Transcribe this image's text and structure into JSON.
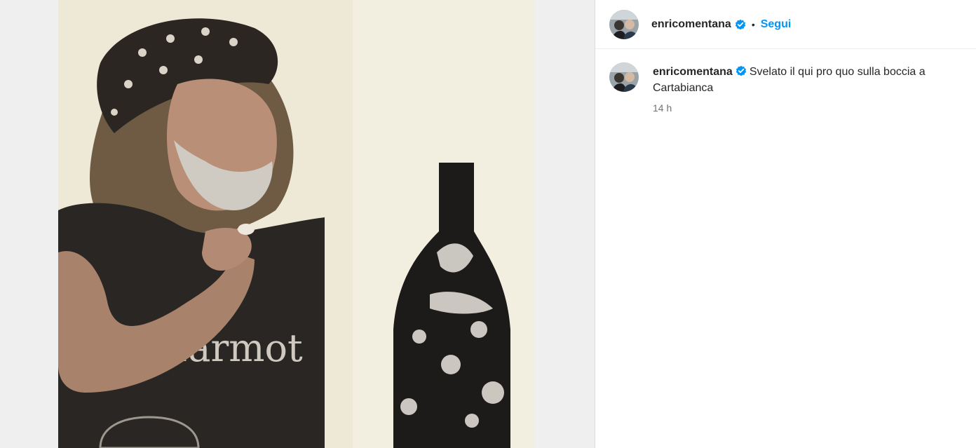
{
  "post": {
    "image_alt": "Photo of a man wearing a bandana and a Marmot t-shirt next to a painted bottle",
    "shirt_text": "Marmot"
  },
  "header": {
    "username": "enricomentana",
    "separator": "•",
    "follow_label": "Segui"
  },
  "caption": {
    "username": "enricomentana",
    "text": "Svelato il qui pro quo sulla boccia a Cartabianca",
    "time": "14 h"
  },
  "colors": {
    "accent": "#0095f6",
    "verified": "#0095f6",
    "text": "#262626",
    "muted": "#737373"
  }
}
